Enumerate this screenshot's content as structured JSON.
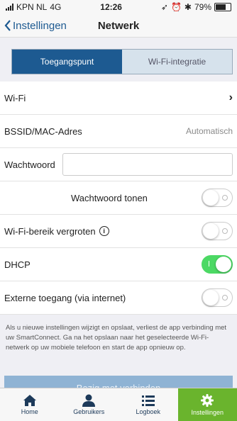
{
  "status": {
    "carrier": "KPN NL",
    "network": "4G",
    "time": "12:26",
    "battery": "79%",
    "battery_level": 0.79
  },
  "nav": {
    "back_label": "Instellingen",
    "title": "Netwerk"
  },
  "segments": {
    "active": "Toegangspunt",
    "inactive": "Wi-Fi-integratie"
  },
  "rows": {
    "wifi": {
      "label": "Wi-Fi"
    },
    "bssid": {
      "label": "BSSID/MAC-Adres",
      "value": "Automatisch"
    },
    "password": {
      "label": "Wachtwoord",
      "value": ""
    },
    "show_password": {
      "label": "Wachtwoord tonen",
      "on": false
    },
    "extend_range": {
      "label": "Wi-Fi-bereik vergroten",
      "on": false
    },
    "dhcp": {
      "label": "DHCP",
      "on": true
    },
    "external": {
      "label": "Externe toegang (via internet)",
      "on": false
    }
  },
  "note": "Als u nieuwe instellingen wijzigt en opslaat, verliest de app verbinding met uw SmartConnect. Ga na het opslaan naar het geselecteerde Wi-Fi-netwerk op uw mobiele telefoon en start de app opnieuw op.",
  "connect_button": "Bezig met verbinden",
  "tabs": [
    {
      "label": "Home",
      "icon": "home-icon"
    },
    {
      "label": "Gebruikers",
      "icon": "user-icon"
    },
    {
      "label": "Logboek",
      "icon": "list-icon"
    },
    {
      "label": "Instellingen",
      "icon": "gear-icon",
      "active": true
    }
  ],
  "colors": {
    "accent": "#1d5a91",
    "toggle_on": "#4cd964",
    "tab_active": "#6ab42d"
  }
}
